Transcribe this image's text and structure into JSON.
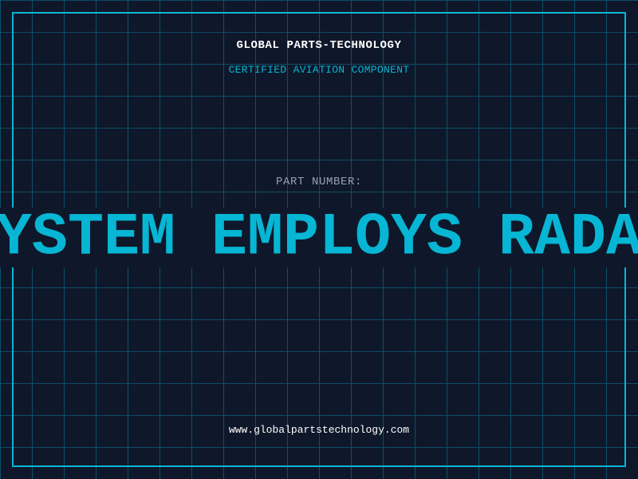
{
  "colors": {
    "background": "#0f172a",
    "grid": "#0e4f66",
    "accent": "#06b6d4",
    "muted": "#94a3b8",
    "text": "#ffffff"
  },
  "header": {
    "title": "GLOBAL PARTS-TECHNOLOGY",
    "subtitle": "CERTIFIED AVIATION COMPONENT"
  },
  "part": {
    "label": "PART NUMBER:",
    "value": "SYSTEM EMPLOYS RADAR"
  },
  "footer": {
    "url": "www.globalpartstechnology.com"
  }
}
